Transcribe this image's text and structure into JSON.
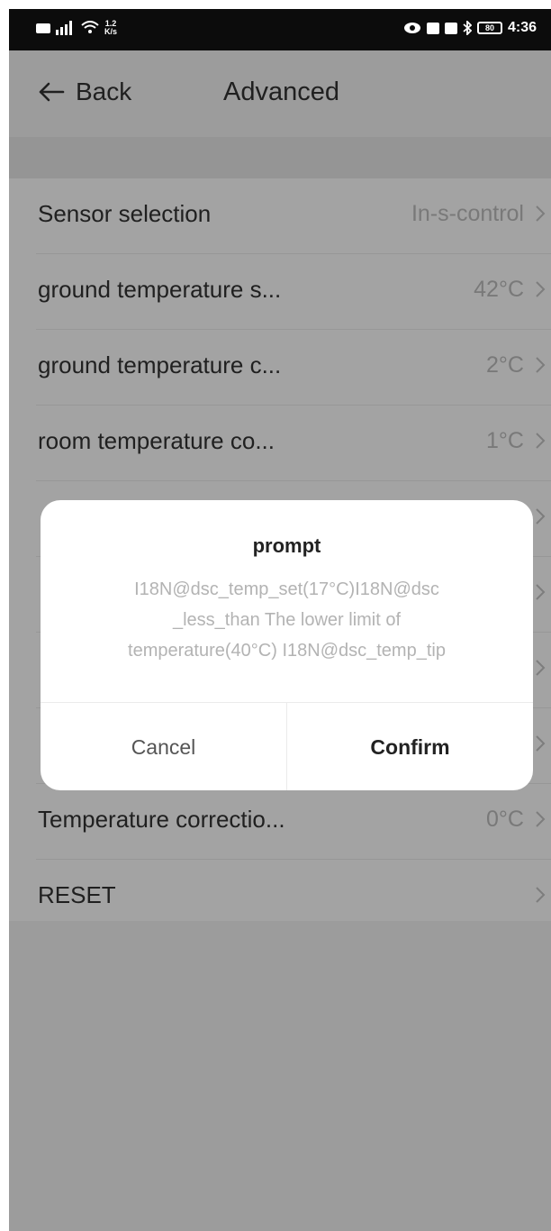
{
  "status_bar": {
    "net_speed_top": "1.2",
    "net_speed_bottom": "K/s",
    "battery": "80",
    "time": "4:36"
  },
  "header": {
    "back_label": "Back",
    "title": "Advanced"
  },
  "settings": {
    "items": [
      {
        "label": "Sensor selection",
        "value": "In-s-control"
      },
      {
        "label": "ground temperature s...",
        "value": "42°C"
      },
      {
        "label": "ground temperature c...",
        "value": "2°C"
      },
      {
        "label": "room temperature co...",
        "value": "1°C"
      },
      {
        "label": "",
        "value": ""
      },
      {
        "label": "",
        "value": ""
      },
      {
        "label": "",
        "value": ""
      },
      {
        "label": "",
        "value": ""
      },
      {
        "label": "Temperature correctio...",
        "value": "0°C"
      },
      {
        "label": "RESET",
        "value": ""
      }
    ]
  },
  "dialog": {
    "title": "prompt",
    "message_line1": "I18N@dsc_temp_set(17°C)I18N@dsc",
    "message_line2": "_less_than The lower limit of",
    "message_line3": "temperature(40°C) I18N@dsc_temp_tip",
    "cancel_label": "Cancel",
    "confirm_label": "Confirm"
  },
  "colors": {
    "overlay": "#000000",
    "value_text": "#bdbdbd",
    "dialog_message": "#b3b3b3"
  }
}
